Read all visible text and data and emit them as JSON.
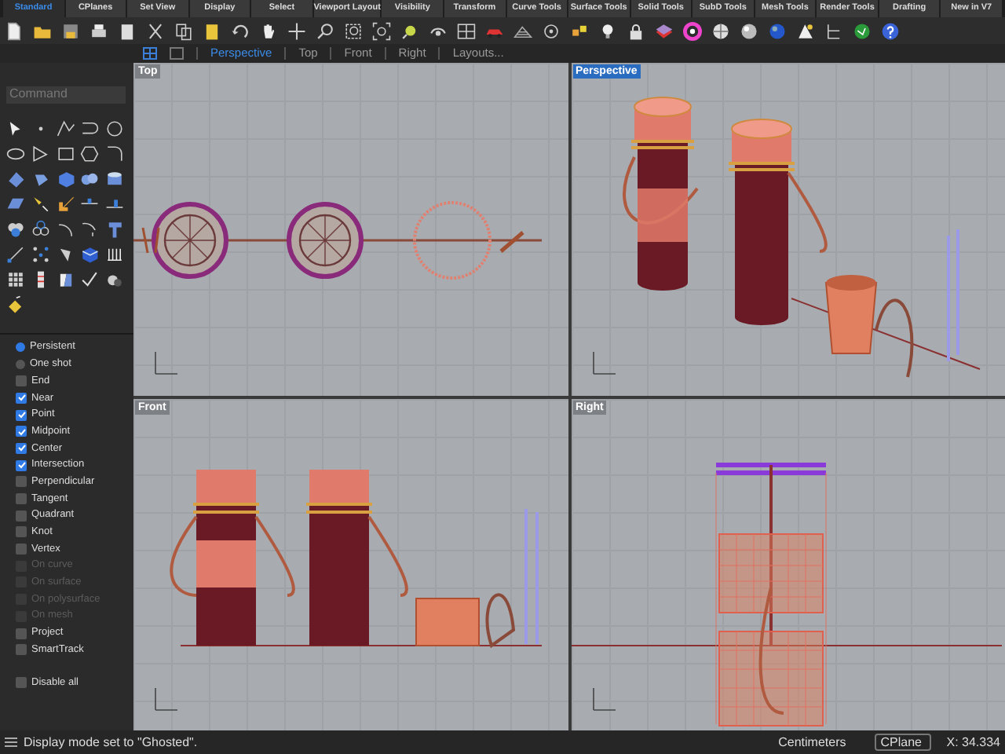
{
  "toolbar_tabs": [
    {
      "label": "Standard",
      "selected": true
    },
    {
      "label": "CPlanes",
      "selected": false
    },
    {
      "label": "Set View",
      "selected": false
    },
    {
      "label": "Display",
      "selected": false
    },
    {
      "label": "Select",
      "selected": false
    },
    {
      "label": "Viewport Layout",
      "selected": false
    },
    {
      "label": "Visibility",
      "selected": false
    },
    {
      "label": "Transform",
      "selected": false
    },
    {
      "label": "Curve Tools",
      "selected": false
    },
    {
      "label": "Surface Tools",
      "selected": false
    },
    {
      "label": "Solid Tools",
      "selected": false
    },
    {
      "label": "SubD Tools",
      "selected": false
    },
    {
      "label": "Mesh Tools",
      "selected": false
    },
    {
      "label": "Render Tools",
      "selected": false
    },
    {
      "label": "Drafting",
      "selected": false
    },
    {
      "label": "New in V7",
      "selected": false
    }
  ],
  "view_tabs": [
    {
      "label": "Perspective",
      "selected": true
    },
    {
      "label": "Top",
      "selected": false
    },
    {
      "label": "Front",
      "selected": false
    },
    {
      "label": "Right",
      "selected": false
    },
    {
      "label": "Layouts...",
      "selected": false
    }
  ],
  "command": {
    "placeholder": "Command"
  },
  "osnap": [
    {
      "kind": "radio",
      "label": "Persistent",
      "selected": true
    },
    {
      "kind": "radio",
      "label": "One shot",
      "selected": false
    },
    {
      "kind": "check",
      "label": "End",
      "checked": false,
      "disabled": false
    },
    {
      "kind": "check",
      "label": "Near",
      "checked": true,
      "disabled": false
    },
    {
      "kind": "check",
      "label": "Point",
      "checked": true,
      "disabled": false
    },
    {
      "kind": "check",
      "label": "Midpoint",
      "checked": true,
      "disabled": false
    },
    {
      "kind": "check",
      "label": "Center",
      "checked": true,
      "disabled": false
    },
    {
      "kind": "check",
      "label": "Intersection",
      "checked": true,
      "disabled": false
    },
    {
      "kind": "check",
      "label": "Perpendicular",
      "checked": false,
      "disabled": false
    },
    {
      "kind": "check",
      "label": "Tangent",
      "checked": false,
      "disabled": false
    },
    {
      "kind": "check",
      "label": "Quadrant",
      "checked": false,
      "disabled": false
    },
    {
      "kind": "check",
      "label": "Knot",
      "checked": false,
      "disabled": false
    },
    {
      "kind": "check",
      "label": "Vertex",
      "checked": false,
      "disabled": false
    },
    {
      "kind": "check",
      "label": "On curve",
      "checked": false,
      "disabled": true
    },
    {
      "kind": "check",
      "label": "On surface",
      "checked": false,
      "disabled": true
    },
    {
      "kind": "check",
      "label": "On polysurface",
      "checked": false,
      "disabled": true
    },
    {
      "kind": "check",
      "label": "On mesh",
      "checked": false,
      "disabled": true
    },
    {
      "kind": "check",
      "label": "Project",
      "checked": false,
      "disabled": false
    },
    {
      "kind": "check",
      "label": "SmartTrack",
      "checked": false,
      "disabled": false
    },
    {
      "kind": "gap"
    },
    {
      "kind": "check",
      "label": "Disable all",
      "checked": false,
      "disabled": false
    }
  ],
  "viewports": [
    {
      "kind": "top",
      "title": "Top",
      "active": false
    },
    {
      "kind": "perspective",
      "title": "Perspective",
      "active": true
    },
    {
      "kind": "front",
      "title": "Front",
      "active": false
    },
    {
      "kind": "right",
      "title": "Right",
      "active": false
    }
  ],
  "status_bar": {
    "message": "Display mode set to \"Ghosted\".",
    "units": "Centimeters",
    "cplane": "CPlane",
    "coordinates": "X: 34.334"
  }
}
